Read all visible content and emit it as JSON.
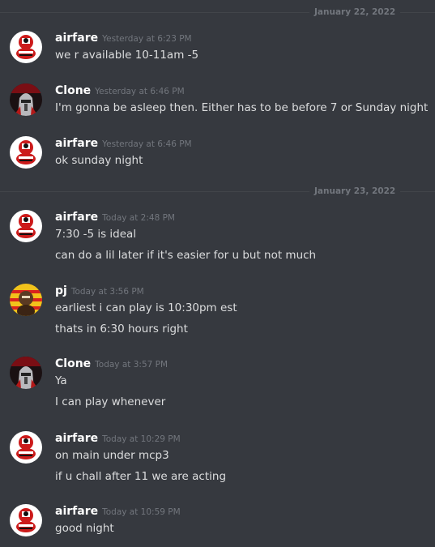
{
  "dividers": [
    "January 22, 2022",
    "January 23, 2022"
  ],
  "messages": [
    {
      "author": "airfare",
      "avatar": "airfare-avatar",
      "time": "Yesterday at 6:23 PM",
      "lines": [
        "we r available 10-11am -5"
      ]
    },
    {
      "author": "Clone",
      "avatar": "clone-avatar",
      "time": "Yesterday at 6:46 PM",
      "lines": [
        "I'm gonna be asleep then. Either has to be before 7 or Sunday night"
      ]
    },
    {
      "author": "airfare",
      "avatar": "airfare-avatar",
      "time": "Yesterday at 6:46 PM",
      "lines": [
        "ok sunday night"
      ]
    },
    {
      "author": "airfare",
      "avatar": "airfare-avatar",
      "time": "Today at 2:48 PM",
      "lines": [
        "7:30 -5 is ideal",
        "can do a lil later if it's easier for u but not much"
      ]
    },
    {
      "author": "pj",
      "avatar": "pj-avatar",
      "time": "Today at 3:56 PM",
      "lines": [
        "earliest i can play is 10:30pm  est",
        "thats in 6:30 hours right"
      ]
    },
    {
      "author": "Clone",
      "avatar": "clone-avatar",
      "time": "Today at 3:57 PM",
      "lines": [
        "Ya",
        "I can play whenever"
      ]
    },
    {
      "author": "airfare",
      "avatar": "airfare-avatar",
      "time": "Today at 10:29 PM",
      "lines": [
        "on main under mcp3",
        "if u chall after 11 we are acting"
      ]
    },
    {
      "author": "airfare",
      "avatar": "airfare-avatar",
      "time": "Today at 10:59 PM",
      "lines": [
        "good night"
      ]
    }
  ],
  "colors": {
    "background": "#36393f",
    "author": "#ffffff",
    "text": "#dcddde",
    "muted": "#72767d"
  }
}
